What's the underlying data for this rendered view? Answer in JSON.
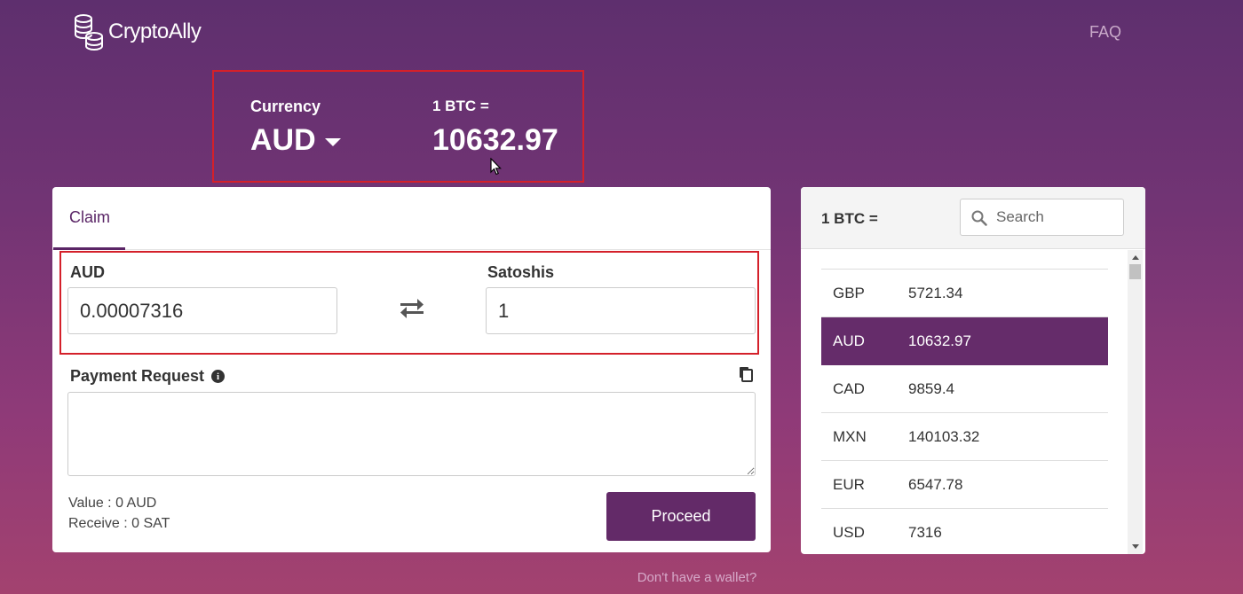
{
  "header": {
    "brand": "CryptoAlly",
    "faq_label": "FAQ"
  },
  "rate_box": {
    "currency_label": "Currency",
    "currency_value": "AUD",
    "btc_label": "1 BTC =",
    "btc_value": "10632.97"
  },
  "claim": {
    "tab_label": "Claim",
    "from_label": "AUD",
    "from_value": "0.00007316",
    "to_label": "Satoshis",
    "to_value": "1",
    "payment_label": "Payment Request",
    "payment_value": "",
    "value_line": "Value : 0 AUD",
    "receive_line": "Receive : 0 SAT",
    "proceed_label": "Proceed"
  },
  "rates": {
    "title": "1 BTC =",
    "search_placeholder": "Search",
    "selected": "AUD",
    "items": [
      {
        "code": "GBP",
        "value": "5721.34"
      },
      {
        "code": "AUD",
        "value": "10632.97"
      },
      {
        "code": "CAD",
        "value": "9859.4"
      },
      {
        "code": "MXN",
        "value": "140103.32"
      },
      {
        "code": "EUR",
        "value": "6547.78"
      },
      {
        "code": "USD",
        "value": "7316"
      }
    ]
  },
  "footer": {
    "no_wallet": "Don't have a wallet?"
  },
  "colors": {
    "accent": "#652c6a",
    "highlight_border": "#d4202a"
  }
}
